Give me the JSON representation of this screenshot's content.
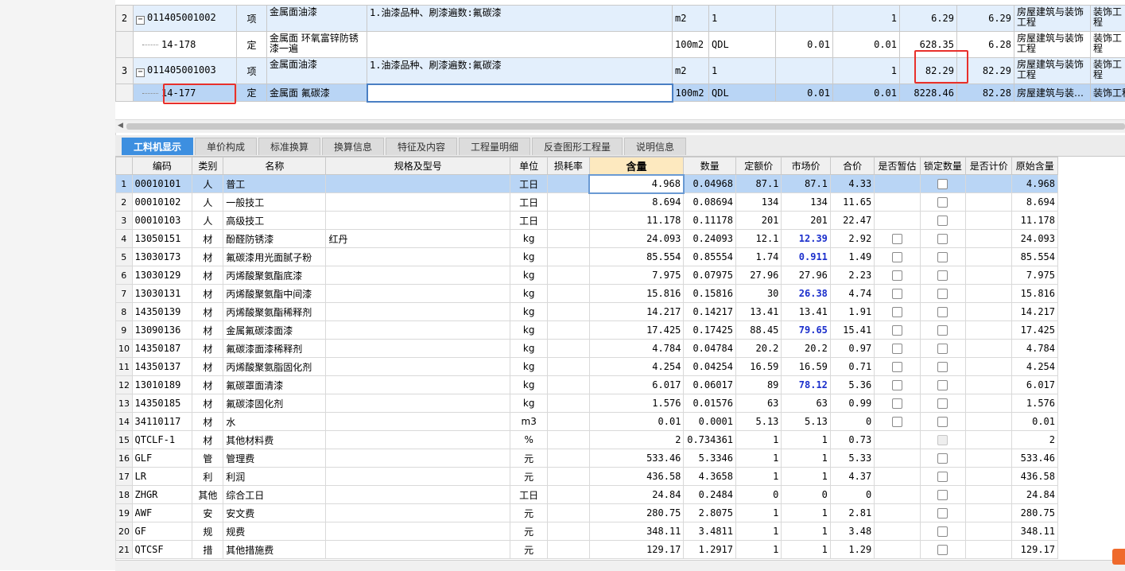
{
  "top_rows": [
    {
      "idx": "2",
      "code": "011405001002",
      "type": "项",
      "name": "金属面油漆",
      "spec": "1.油漆品种、刷漆遍数:氟碳漆",
      "unit": "m2",
      "expr": "1",
      "c9": "",
      "c10": "1",
      "c11": "6.29",
      "c12": "6.29",
      "c13": "房屋建筑与装饰工程",
      "c14": "装饰工程",
      "kind": "xiang"
    },
    {
      "idx": "",
      "code": "14-178",
      "type": "定",
      "name": "金属面 环氧富锌防锈漆一遍",
      "spec": "",
      "unit": "100m2",
      "expr": "QDL",
      "c9": "0.01",
      "c10": "0.01",
      "c11": "628.35",
      "c12": "6.28",
      "c13": "房屋建筑与装饰工程",
      "c14": "装饰工程",
      "kind": "ding"
    },
    {
      "idx": "3",
      "code": "011405001003",
      "type": "项",
      "name": "金属面油漆",
      "spec": "1.油漆品种、刷漆遍数:氟碳漆",
      "unit": "m2",
      "expr": "1",
      "c9": "",
      "c10": "1",
      "c11": "82.29",
      "c12": "82.29",
      "c13": "房屋建筑与装饰工程",
      "c14": "装饰工程",
      "kind": "xiang"
    },
    {
      "idx": "",
      "code": "14-177",
      "type": "定",
      "name": "金属面 氟碳漆",
      "spec": "",
      "unit": "100m2",
      "expr": "QDL",
      "c9": "0.01",
      "c10": "0.01",
      "c11": "8228.46",
      "c12": "82.28",
      "c13": "房屋建筑与装…",
      "c14": "装饰工程",
      "kind": "sel"
    }
  ],
  "tabs": [
    "工料机显示",
    "单价构成",
    "标准换算",
    "换算信息",
    "特征及内容",
    "工程量明细",
    "反查图形工程量",
    "说明信息"
  ],
  "headers": [
    "编码",
    "类别",
    "名称",
    "规格及型号",
    "单位",
    "损耗率",
    "含量",
    "数量",
    "定额价",
    "市场价",
    "合价",
    "是否暂估",
    "锁定数量",
    "是否计价",
    "原始含量"
  ],
  "rows": [
    {
      "idx": "1",
      "code": "00010101",
      "cat": "人",
      "name": "普工",
      "spec": "",
      "unit": "工日",
      "loss": "",
      "qty": "4.968",
      "amount": "0.04968",
      "quota": "87.1",
      "market": "87.1",
      "total": "4.33",
      "est": "none",
      "lock": "cb",
      "orig": "4.968",
      "blue": false
    },
    {
      "idx": "2",
      "code": "00010102",
      "cat": "人",
      "name": "一般技工",
      "spec": "",
      "unit": "工日",
      "loss": "",
      "qty": "8.694",
      "amount": "0.08694",
      "quota": "134",
      "market": "134",
      "total": "11.65",
      "est": "none",
      "lock": "cb",
      "orig": "8.694",
      "blue": false
    },
    {
      "idx": "3",
      "code": "00010103",
      "cat": "人",
      "name": "高级技工",
      "spec": "",
      "unit": "工日",
      "loss": "",
      "qty": "11.178",
      "amount": "0.11178",
      "quota": "201",
      "market": "201",
      "total": "22.47",
      "est": "none",
      "lock": "cb",
      "orig": "11.178",
      "blue": false
    },
    {
      "idx": "4",
      "code": "13050151",
      "cat": "材",
      "name": "酚醛防锈漆",
      "spec": "红丹",
      "unit": "kg",
      "loss": "",
      "qty": "24.093",
      "amount": "0.24093",
      "quota": "12.1",
      "market": "12.39",
      "total": "2.92",
      "est": "cb",
      "lock": "cb",
      "orig": "24.093",
      "blue": true
    },
    {
      "idx": "5",
      "code": "13030173",
      "cat": "材",
      "name": "氟碳漆用光面腻子粉",
      "spec": "",
      "unit": "kg",
      "loss": "",
      "qty": "85.554",
      "amount": "0.85554",
      "quota": "1.74",
      "market": "0.911",
      "total": "1.49",
      "est": "cb",
      "lock": "cb",
      "orig": "85.554",
      "blue": true
    },
    {
      "idx": "6",
      "code": "13030129",
      "cat": "材",
      "name": "丙烯酸聚氨酯底漆",
      "spec": "",
      "unit": "kg",
      "loss": "",
      "qty": "7.975",
      "amount": "0.07975",
      "quota": "27.96",
      "market": "27.96",
      "total": "2.23",
      "est": "cb",
      "lock": "cb",
      "orig": "7.975",
      "blue": false
    },
    {
      "idx": "7",
      "code": "13030131",
      "cat": "材",
      "name": "丙烯酸聚氨酯中间漆",
      "spec": "",
      "unit": "kg",
      "loss": "",
      "qty": "15.816",
      "amount": "0.15816",
      "quota": "30",
      "market": "26.38",
      "total": "4.74",
      "est": "cb",
      "lock": "cb",
      "orig": "15.816",
      "blue": true
    },
    {
      "idx": "8",
      "code": "14350139",
      "cat": "材",
      "name": "丙烯酸聚氨酯稀释剂",
      "spec": "",
      "unit": "kg",
      "loss": "",
      "qty": "14.217",
      "amount": "0.14217",
      "quota": "13.41",
      "market": "13.41",
      "total": "1.91",
      "est": "cb",
      "lock": "cb",
      "orig": "14.217",
      "blue": false
    },
    {
      "idx": "9",
      "code": "13090136",
      "cat": "材",
      "name": "金属氟碳漆面漆",
      "spec": "",
      "unit": "kg",
      "loss": "",
      "qty": "17.425",
      "amount": "0.17425",
      "quota": "88.45",
      "market": "79.65",
      "total": "15.41",
      "est": "cb",
      "lock": "cb",
      "orig": "17.425",
      "blue": true
    },
    {
      "idx": "10",
      "code": "14350187",
      "cat": "材",
      "name": "氟碳漆面漆稀释剂",
      "spec": "",
      "unit": "kg",
      "loss": "",
      "qty": "4.784",
      "amount": "0.04784",
      "quota": "20.2",
      "market": "20.2",
      "total": "0.97",
      "est": "cb",
      "lock": "cb",
      "orig": "4.784",
      "blue": false
    },
    {
      "idx": "11",
      "code": "14350137",
      "cat": "材",
      "name": "丙烯酸聚氨脂固化剂",
      "spec": "",
      "unit": "kg",
      "loss": "",
      "qty": "4.254",
      "amount": "0.04254",
      "quota": "16.59",
      "market": "16.59",
      "total": "0.71",
      "est": "cb",
      "lock": "cb",
      "orig": "4.254",
      "blue": false
    },
    {
      "idx": "12",
      "code": "13010189",
      "cat": "材",
      "name": "氟碳罩面清漆",
      "spec": "",
      "unit": "kg",
      "loss": "",
      "qty": "6.017",
      "amount": "0.06017",
      "quota": "89",
      "market": "78.12",
      "total": "5.36",
      "est": "cb",
      "lock": "cb",
      "orig": "6.017",
      "blue": true
    },
    {
      "idx": "13",
      "code": "14350185",
      "cat": "材",
      "name": "氟碳漆固化剂",
      "spec": "",
      "unit": "kg",
      "loss": "",
      "qty": "1.576",
      "amount": "0.01576",
      "quota": "63",
      "market": "63",
      "total": "0.99",
      "est": "cb",
      "lock": "cb",
      "orig": "1.576",
      "blue": false
    },
    {
      "idx": "14",
      "code": "34110117",
      "cat": "材",
      "name": "水",
      "spec": "",
      "unit": "m3",
      "loss": "",
      "qty": "0.01",
      "amount": "0.0001",
      "quota": "5.13",
      "market": "5.13",
      "total": "0",
      "est": "cb",
      "lock": "cb",
      "orig": "0.01",
      "blue": false
    },
    {
      "idx": "15",
      "code": "QTCLF-1",
      "cat": "材",
      "name": "其他材料费",
      "spec": "",
      "unit": "%",
      "loss": "",
      "qty": "2",
      "amount": "0.734361",
      "quota": "1",
      "market": "1",
      "total": "0.73",
      "est": "none",
      "lock": "dis",
      "orig": "2",
      "blue": false
    },
    {
      "idx": "16",
      "code": "GLF",
      "cat": "管",
      "name": "管理费",
      "spec": "",
      "unit": "元",
      "loss": "",
      "qty": "533.46",
      "amount": "5.3346",
      "quota": "1",
      "market": "1",
      "total": "5.33",
      "est": "none",
      "lock": "cb",
      "orig": "533.46",
      "blue": false
    },
    {
      "idx": "17",
      "code": "LR",
      "cat": "利",
      "name": "利润",
      "spec": "",
      "unit": "元",
      "loss": "",
      "qty": "436.58",
      "amount": "4.3658",
      "quota": "1",
      "market": "1",
      "total": "4.37",
      "est": "none",
      "lock": "cb",
      "orig": "436.58",
      "blue": false
    },
    {
      "idx": "18",
      "code": "ZHGR",
      "cat": "其他",
      "name": "综合工日",
      "spec": "",
      "unit": "工日",
      "loss": "",
      "qty": "24.84",
      "amount": "0.2484",
      "quota": "0",
      "market": "0",
      "total": "0",
      "est": "none",
      "lock": "cb",
      "orig": "24.84",
      "blue": false
    },
    {
      "idx": "19",
      "code": "AWF",
      "cat": "安",
      "name": "安文费",
      "spec": "",
      "unit": "元",
      "loss": "",
      "qty": "280.75",
      "amount": "2.8075",
      "quota": "1",
      "market": "1",
      "total": "2.81",
      "est": "none",
      "lock": "cb",
      "orig": "280.75",
      "blue": false
    },
    {
      "idx": "20",
      "code": "GF",
      "cat": "规",
      "name": "规费",
      "spec": "",
      "unit": "元",
      "loss": "",
      "qty": "348.11",
      "amount": "3.4811",
      "quota": "1",
      "market": "1",
      "total": "3.48",
      "est": "none",
      "lock": "cb",
      "orig": "348.11",
      "blue": false
    },
    {
      "idx": "21",
      "code": "QTCSF",
      "cat": "措",
      "name": "其他措施费",
      "spec": "",
      "unit": "元",
      "loss": "",
      "qty": "129.17",
      "amount": "1.2917",
      "quota": "1",
      "market": "1",
      "total": "1.29",
      "est": "none",
      "lock": "cb",
      "orig": "129.17",
      "blue": false
    }
  ],
  "colors": {
    "accent": "#3d8fe0",
    "selected_row": "#b9d5f5",
    "highlight_value": "#1b2fcc",
    "annotation_box": "#e8302b"
  }
}
